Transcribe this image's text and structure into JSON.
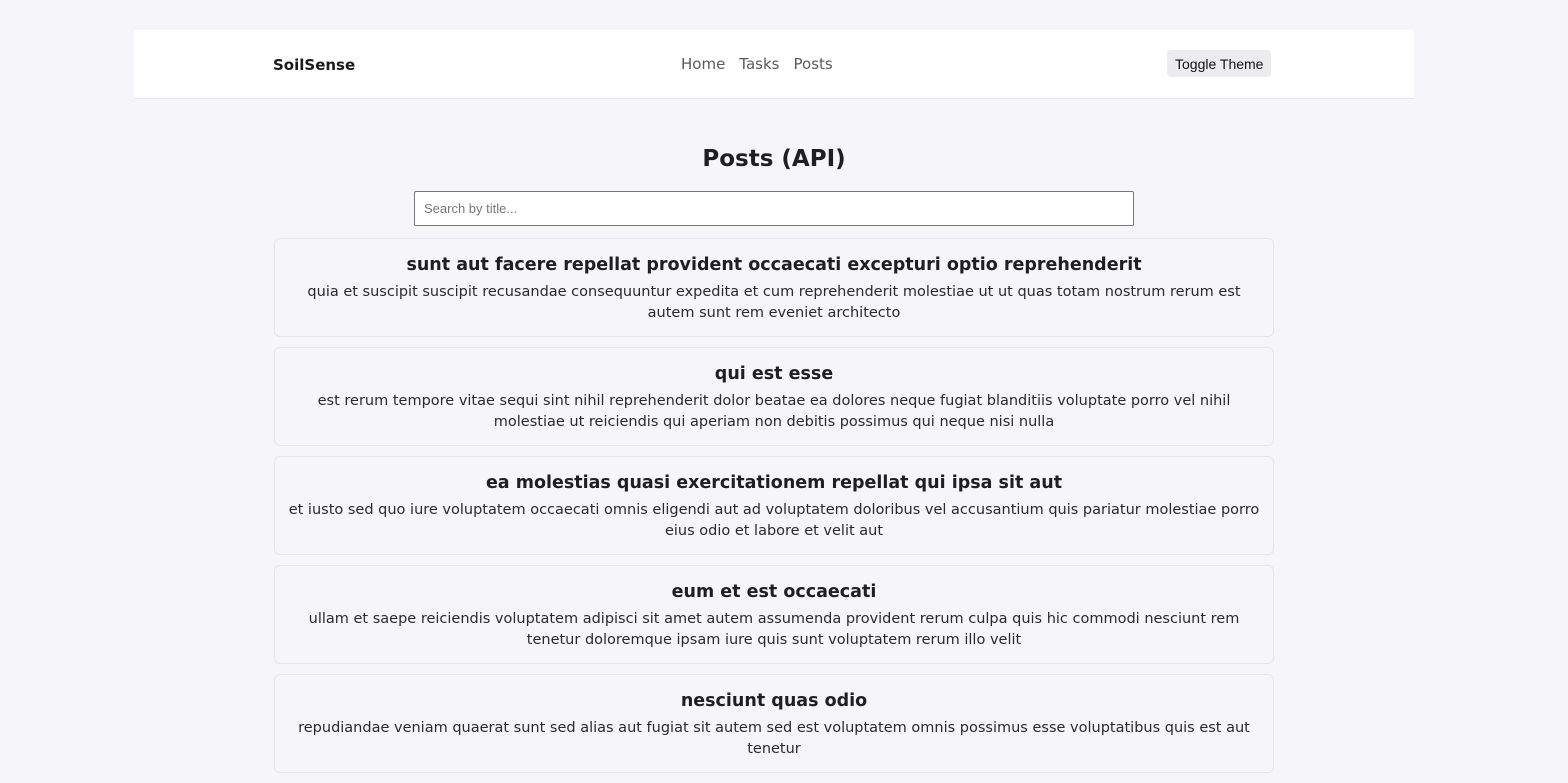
{
  "navbar": {
    "brand": "SoilSense",
    "links": [
      {
        "label": "Home"
      },
      {
        "label": "Tasks"
      },
      {
        "label": "Posts"
      }
    ],
    "theme_button_label": "Toggle Theme"
  },
  "page": {
    "title": "Posts (API)",
    "search_placeholder": "Search by title..."
  },
  "posts": [
    {
      "title": "sunt aut facere repellat provident occaecati excepturi optio reprehenderit",
      "body": "quia et suscipit suscipit recusandae consequuntur expedita et cum reprehenderit molestiae ut ut quas totam nostrum rerum est autem sunt rem eveniet architecto"
    },
    {
      "title": "qui est esse",
      "body": "est rerum tempore vitae sequi sint nihil reprehenderit dolor beatae ea dolores neque fugiat blanditiis voluptate porro vel nihil molestiae ut reiciendis qui aperiam non debitis possimus qui neque nisi nulla"
    },
    {
      "title": "ea molestias quasi exercitationem repellat qui ipsa sit aut",
      "body": "et iusto sed quo iure voluptatem occaecati omnis eligendi aut ad voluptatem doloribus vel accusantium quis pariatur molestiae porro eius odio et labore et velit aut"
    },
    {
      "title": "eum et est occaecati",
      "body": "ullam et saepe reiciendis voluptatem adipisci sit amet autem assumenda provident rerum culpa quis hic commodi nesciunt rem tenetur doloremque ipsam iure quis sunt voluptatem rerum illo velit"
    },
    {
      "title": "nesciunt quas odio",
      "body": "repudiandae veniam quaerat sunt sed alias aut fugiat sit autem sed est voluptatem omnis possimus esse voluptatibus quis est aut tenetur"
    }
  ]
}
